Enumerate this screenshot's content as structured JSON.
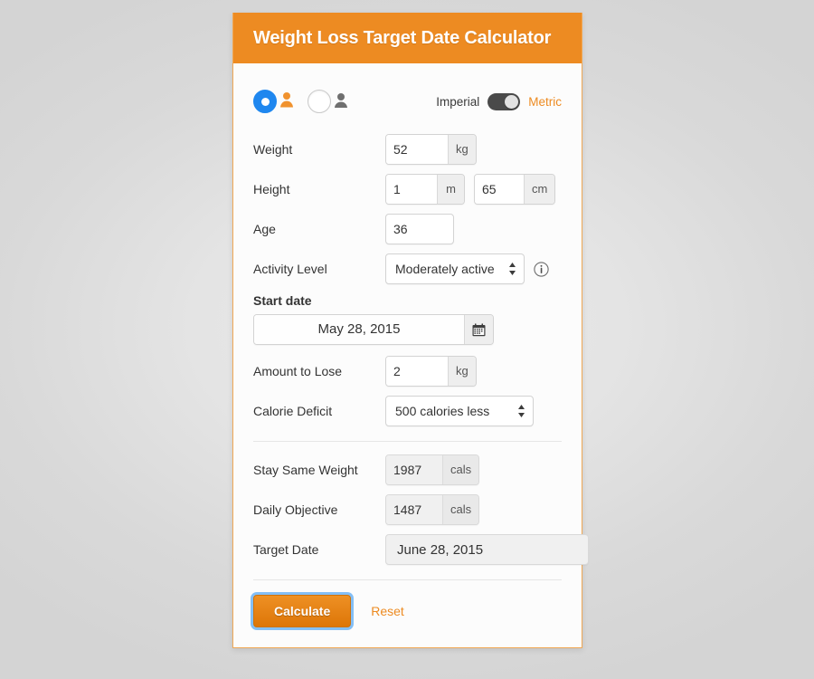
{
  "header": {
    "title": "Weight Loss Target Date Calculator"
  },
  "gender": {
    "female": {
      "icon": "person-female-icon",
      "selected": true
    },
    "male": {
      "icon": "person-male-icon",
      "selected": false
    }
  },
  "units": {
    "imperial_label": "Imperial",
    "metric_label": "Metric",
    "selected": "Metric",
    "accent_color": "#ed8b22"
  },
  "form": {
    "weight": {
      "label": "Weight",
      "value": "52",
      "unit": "kg"
    },
    "height": {
      "label": "Height",
      "meters": "1",
      "m_unit": "m",
      "centimeters": "65",
      "cm_unit": "cm"
    },
    "age": {
      "label": "Age",
      "value": "36"
    },
    "activity": {
      "label": "Activity Level",
      "value": "Moderately active",
      "info_icon": "info-circle-icon"
    },
    "start_date": {
      "label": "Start date",
      "value": "May 28, 2015",
      "calendar_icon": "calendar-icon"
    },
    "amount_to_lose": {
      "label": "Amount to Lose",
      "value": "2",
      "unit": "kg"
    },
    "calorie_deficit": {
      "label": "Calorie Deficit",
      "value": "500 calories less"
    }
  },
  "results": {
    "stay_same_weight": {
      "label": "Stay Same Weight",
      "value": "1987",
      "unit": "cals"
    },
    "daily_objective": {
      "label": "Daily Objective",
      "value": "1487",
      "unit": "cals"
    },
    "target_date": {
      "label": "Target Date",
      "value": "June 28, 2015"
    }
  },
  "footer": {
    "calculate_label": "Calculate",
    "reset_label": "Reset"
  }
}
